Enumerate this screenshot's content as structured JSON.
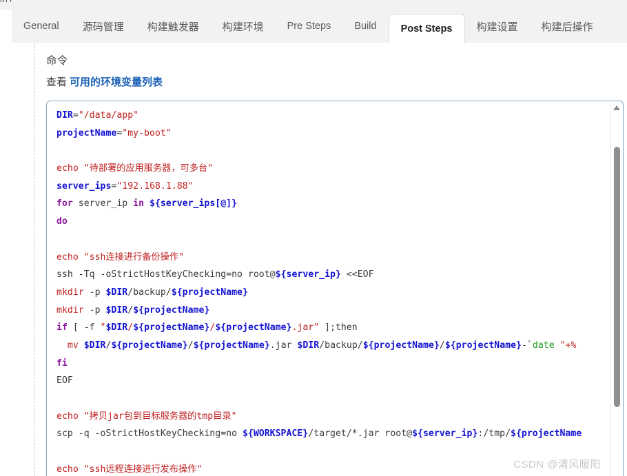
{
  "breadcrumb": {
    "text": "m  /"
  },
  "tabs": [
    {
      "label": "General",
      "active": false
    },
    {
      "label": "源码管理",
      "active": false
    },
    {
      "label": "构建触发器",
      "active": false
    },
    {
      "label": "构建环境",
      "active": false
    },
    {
      "label": "Pre Steps",
      "active": false
    },
    {
      "label": "Build",
      "active": false
    },
    {
      "label": "Post Steps",
      "active": true
    },
    {
      "label": "构建设置",
      "active": false
    },
    {
      "label": "构建后操作",
      "active": false
    }
  ],
  "form": {
    "field_label": "命令",
    "help_prefix": "查看",
    "help_link": "可用的环境变量列表"
  },
  "code": {
    "language": "bash",
    "lines": [
      [
        {
          "t": "var",
          "v": "DIR"
        },
        {
          "t": "op",
          "v": "="
        },
        {
          "t": "str",
          "v": "\"/data/app\""
        }
      ],
      [
        {
          "t": "var",
          "v": "projectName"
        },
        {
          "t": "op",
          "v": "="
        },
        {
          "t": "str",
          "v": "\"my-boot\""
        }
      ],
      [],
      [
        {
          "t": "cmd",
          "v": "echo"
        },
        {
          "t": "plain",
          "v": " "
        },
        {
          "t": "str",
          "v": "\"待部署的应用服务器，可多台\""
        }
      ],
      [
        {
          "t": "var",
          "v": "server_ips"
        },
        {
          "t": "op",
          "v": "="
        },
        {
          "t": "str",
          "v": "\"192.168.1.88\""
        }
      ],
      [
        {
          "t": "kw",
          "v": "for"
        },
        {
          "t": "plain",
          "v": " server_ip "
        },
        {
          "t": "kw",
          "v": "in"
        },
        {
          "t": "plain",
          "v": " "
        },
        {
          "t": "var",
          "v": "${server_ips[@]}"
        }
      ],
      [
        {
          "t": "kw",
          "v": "do"
        }
      ],
      [],
      [
        {
          "t": "cmd",
          "v": "echo"
        },
        {
          "t": "plain",
          "v": " "
        },
        {
          "t": "str",
          "v": "\"ssh连接进行备份操作\""
        }
      ],
      [
        {
          "t": "plain",
          "v": "ssh -Tq -oStrictHostKeyChecking"
        },
        {
          "t": "op",
          "v": "="
        },
        {
          "t": "plain",
          "v": "no root@"
        },
        {
          "t": "var",
          "v": "${server_ip}"
        },
        {
          "t": "plain",
          "v": " <<EOF"
        }
      ],
      [
        {
          "t": "cmd",
          "v": "mkdir"
        },
        {
          "t": "plain",
          "v": " -p "
        },
        {
          "t": "var",
          "v": "$DIR"
        },
        {
          "t": "plain",
          "v": "/backup/"
        },
        {
          "t": "var",
          "v": "${projectName}"
        }
      ],
      [
        {
          "t": "cmd",
          "v": "mkdir"
        },
        {
          "t": "plain",
          "v": " -p "
        },
        {
          "t": "var",
          "v": "$DIR"
        },
        {
          "t": "plain",
          "v": "/"
        },
        {
          "t": "var",
          "v": "${projectName}"
        }
      ],
      [
        {
          "t": "kw",
          "v": "if"
        },
        {
          "t": "plain",
          "v": " [ -f "
        },
        {
          "t": "str",
          "v": "\""
        },
        {
          "t": "var",
          "v": "$DIR"
        },
        {
          "t": "str",
          "v": "/"
        },
        {
          "t": "var",
          "v": "${projectName}"
        },
        {
          "t": "str",
          "v": "/"
        },
        {
          "t": "var",
          "v": "${projectName}"
        },
        {
          "t": "str",
          "v": ".jar\""
        },
        {
          "t": "plain",
          "v": " ];then"
        }
      ],
      [
        {
          "t": "plain",
          "v": "  "
        },
        {
          "t": "cmd",
          "v": "mv"
        },
        {
          "t": "plain",
          "v": " "
        },
        {
          "t": "var",
          "v": "$DIR"
        },
        {
          "t": "plain",
          "v": "/"
        },
        {
          "t": "var",
          "v": "${projectName}"
        },
        {
          "t": "plain",
          "v": "/"
        },
        {
          "t": "var",
          "v": "${projectName}"
        },
        {
          "t": "plain",
          "v": ".jar "
        },
        {
          "t": "var",
          "v": "$DIR"
        },
        {
          "t": "plain",
          "v": "/backup/"
        },
        {
          "t": "var",
          "v": "${projectName}"
        },
        {
          "t": "plain",
          "v": "/"
        },
        {
          "t": "var",
          "v": "${projectName}"
        },
        {
          "t": "plain",
          "v": "-`"
        },
        {
          "t": "builtin",
          "v": "date"
        },
        {
          "t": "plain",
          "v": " "
        },
        {
          "t": "str",
          "v": "\"+%"
        }
      ],
      [
        {
          "t": "kw",
          "v": "fi"
        }
      ],
      [
        {
          "t": "plain",
          "v": "EOF"
        }
      ],
      [],
      [
        {
          "t": "cmd",
          "v": "echo"
        },
        {
          "t": "plain",
          "v": " "
        },
        {
          "t": "str",
          "v": "\"拷贝jar包到目标服务器的tmp目录\""
        }
      ],
      [
        {
          "t": "plain",
          "v": "scp -q -oStrictHostKeyChecking"
        },
        {
          "t": "op",
          "v": "="
        },
        {
          "t": "plain",
          "v": "no "
        },
        {
          "t": "var",
          "v": "${WORKSPACE}"
        },
        {
          "t": "plain",
          "v": "/target/*.jar root@"
        },
        {
          "t": "var",
          "v": "${server_ip}"
        },
        {
          "t": "plain",
          "v": ":/tmp/"
        },
        {
          "t": "var",
          "v": "${projectName"
        }
      ],
      [],
      [
        {
          "t": "cmd",
          "v": "echo"
        },
        {
          "t": "plain",
          "v": " "
        },
        {
          "t": "str",
          "v": "\"ssh远程连接进行发布操作\""
        }
      ]
    ]
  },
  "scrollbar": {
    "arrow_up": "triangle-up"
  },
  "watermark": {
    "text": "CSDN @清风暖阳"
  },
  "colors": {
    "link": "#1f62b8",
    "tab_strip_bg": "#f2f2f2",
    "code_border": "#8aa9c0",
    "string": "#c02020",
    "variable": "#1414d2",
    "keyword": "#8b1a9e",
    "builtin": "#1a9a1a"
  }
}
